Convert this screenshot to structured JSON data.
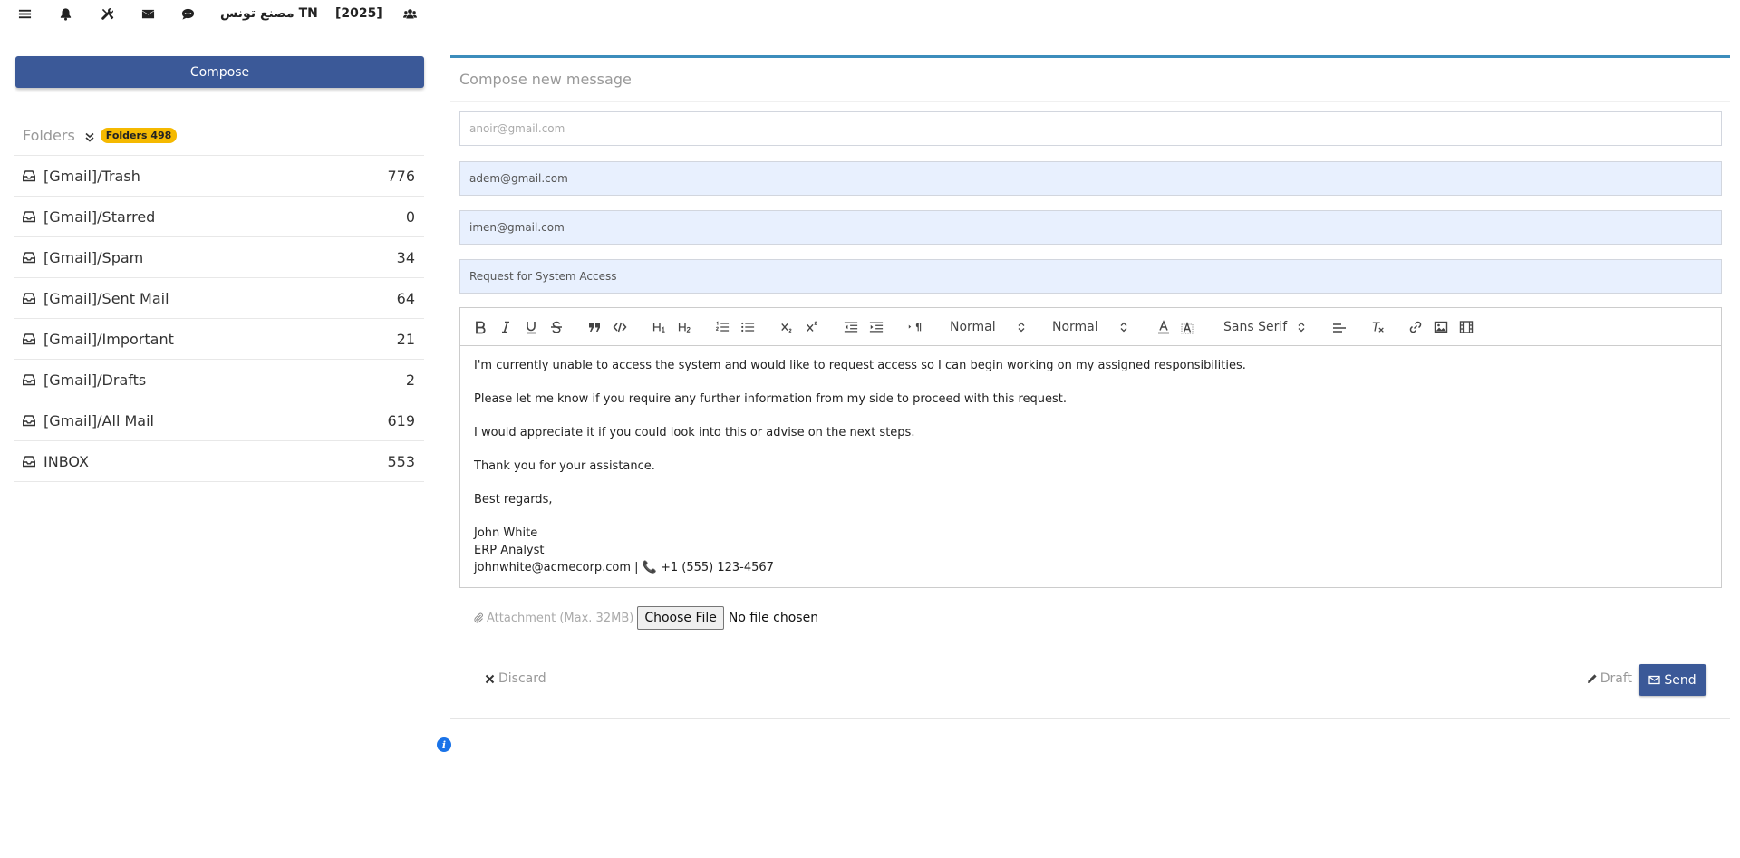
{
  "topbar": {
    "company": "مصنع تونس TN",
    "year": "[2025]",
    "icons": [
      "menu-icon",
      "bell-icon",
      "tools-icon",
      "envelope-icon",
      "chat-icon",
      "users-icon"
    ]
  },
  "sidebar": {
    "compose_label": "Compose",
    "folders_title": "Folders",
    "folders_badge": "Folders 498",
    "badge_color": "#f5b900",
    "folders": [
      {
        "name": "[Gmail]/Trash",
        "count": "776"
      },
      {
        "name": "[Gmail]/Starred",
        "count": "0"
      },
      {
        "name": "[Gmail]/Spam",
        "count": "34"
      },
      {
        "name": "[Gmail]/Sent Mail",
        "count": "64"
      },
      {
        "name": "[Gmail]/Important",
        "count": "21"
      },
      {
        "name": "[Gmail]/Drafts",
        "count": "2"
      },
      {
        "name": "[Gmail]/All Mail",
        "count": "619"
      },
      {
        "name": "INBOX",
        "count": "553"
      }
    ]
  },
  "compose": {
    "title": "Compose new message",
    "to_placeholder": "anoir@gmail.com",
    "cc_value": "adem@gmail.com",
    "bcc_value": "imen@gmail.com",
    "subject_value": "Request for System Access",
    "toolbar": {
      "header_picker": "Normal",
      "size_picker": "Normal",
      "font_picker": "Sans Serif"
    },
    "body": {
      "p1": "I'm currently unable to access the system and would like to request access so I can begin working on my assigned responsibilities.",
      "p2": "Please let me know if you require any further information from my side to proceed with this request.",
      "p3": "I would appreciate it if you could look into this or advise on the next steps.",
      "p4": "Thank you for your assistance.",
      "p5": "Best regards,",
      "sig_name": "John White",
      "sig_title": "ERP Analyst",
      "sig_email": "johnwhite@acmecorp.com",
      "sig_sep": " | ",
      "sig_phone": "+1 (555) 123-4567"
    },
    "attachment_label": "Attachment (Max. 32MB)",
    "choose_file_label": "Choose File",
    "no_file_text": "No file chosen",
    "discard_label": "Discard",
    "draft_label": "Draft",
    "send_label": "Send"
  },
  "colors": {
    "primary": "#3b5998",
    "panel_accent": "#3c8dbc",
    "autofill_bg": "#e8f0fe",
    "info": "#1a73e8"
  }
}
